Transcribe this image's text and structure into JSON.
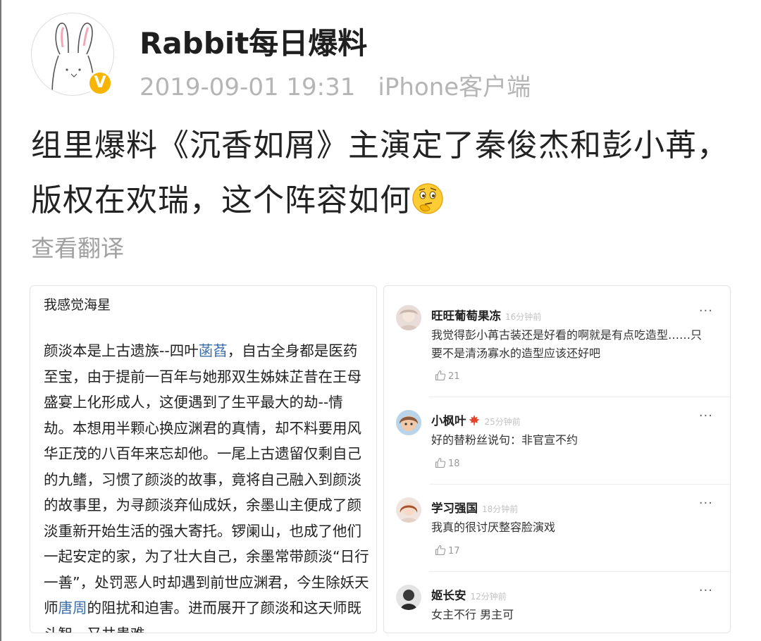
{
  "post": {
    "username": "Rabbit每日爆料",
    "timestamp": "2019-09-01 19:31",
    "client": "iPhone客户端",
    "text": "组里爆料《沉香如屑》主演定了秦俊杰和彭小苒，版权在欢瑞，这个阵容如何",
    "emoji": "thinking-face-icon",
    "translate_label": "查看翻译",
    "verified_badge": "V"
  },
  "left_panel": {
    "title": "我感觉海星",
    "body_parts": [
      "颜淡本是上古遗族--四叶",
      "菡萏",
      "，自古全身都是医药至宝，由于提前一百年与她那双生姊妹芷昔在王母盛宴上化形成人，这便遇到了生平最大的劫--情劫。本想用半颗心换应渊君的真情，却不料要用风华正茂的八百年来忘却他。一尾上古遗留仅剩自己的九鳍，习惯了颜淡的故事，竟将自己融入到颜淡的故事里，为寻颜淡弃仙成妖，余墨山主便成了颜淡重新开始生活的强大寄托。锣阑山，也成了他们一起安定的家，为了壮大自己，余墨常带颜淡“日行一善”，处罚恶人时却遇到前世应渊君，今生除妖天师",
      "唐周",
      "的阻扰和迫害。进而展开了颜淡和这天师既斗智，又共患难"
    ]
  },
  "comments": [
    {
      "name": "旺旺葡萄果冻",
      "time": "16分钟前",
      "text": "我觉得彭小苒古装还是好看的啊就是有点吃造型……只要不是清汤寡水的造型应该还好吧",
      "likes": "21",
      "more": "···"
    },
    {
      "name": "小枫叶",
      "time": "25分钟前",
      "text": "好的替粉丝说句：非官宣不约",
      "likes": "18",
      "more": "···"
    },
    {
      "name": "学习强国",
      "time": "18分钟前",
      "text": "我真的很讨厌整容脸演戏",
      "likes": "17",
      "more": "···"
    },
    {
      "name": "姬长安",
      "time": "12分钟前",
      "text": "女主不行 男主可",
      "likes": "",
      "more": "···"
    }
  ],
  "colors": {
    "link": "#3b6ea8",
    "badge": "#f7b500",
    "muted": "#b5b5b5"
  }
}
